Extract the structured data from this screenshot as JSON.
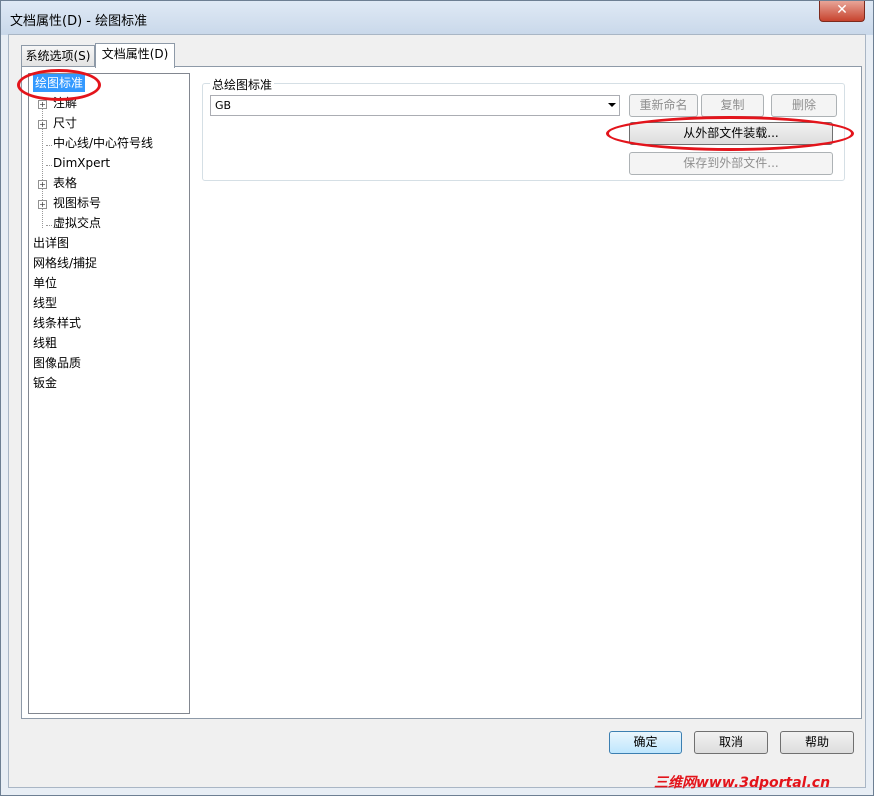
{
  "window": {
    "title": "文档属性(D) - 绘图标准",
    "close_glyph": "✕"
  },
  "tabs": [
    {
      "label": "系统选项(S)"
    },
    {
      "label": "文档属性(D)"
    }
  ],
  "tree": {
    "items": [
      {
        "label": "绘图标准"
      },
      {
        "label": "注解"
      },
      {
        "label": "尺寸"
      },
      {
        "label": "中心线/中心符号线"
      },
      {
        "label": "DimXpert"
      },
      {
        "label": "表格"
      },
      {
        "label": "视图标号"
      },
      {
        "label": "虚拟交点"
      },
      {
        "label": "出详图"
      },
      {
        "label": "网格线/捕捉"
      },
      {
        "label": "单位"
      },
      {
        "label": "线型"
      },
      {
        "label": "线条样式"
      },
      {
        "label": "线粗"
      },
      {
        "label": "图像品质"
      },
      {
        "label": "钣金"
      }
    ],
    "expander_glyph": "+"
  },
  "standard": {
    "group_label": "总绘图标准",
    "selected_value": "GB",
    "rename_label": "重新命名",
    "copy_label": "复制",
    "delete_label": "删除",
    "load_label": "从外部文件装载...",
    "save_label": "保存到外部文件..."
  },
  "footer": {
    "ok_label": "确定",
    "cancel_label": "取消",
    "help_label": "帮助"
  },
  "watermark": "三维网www.3dportal.cn",
  "colors": {
    "annotation_red": "#e3141b",
    "selection_blue": "#3399ff"
  }
}
